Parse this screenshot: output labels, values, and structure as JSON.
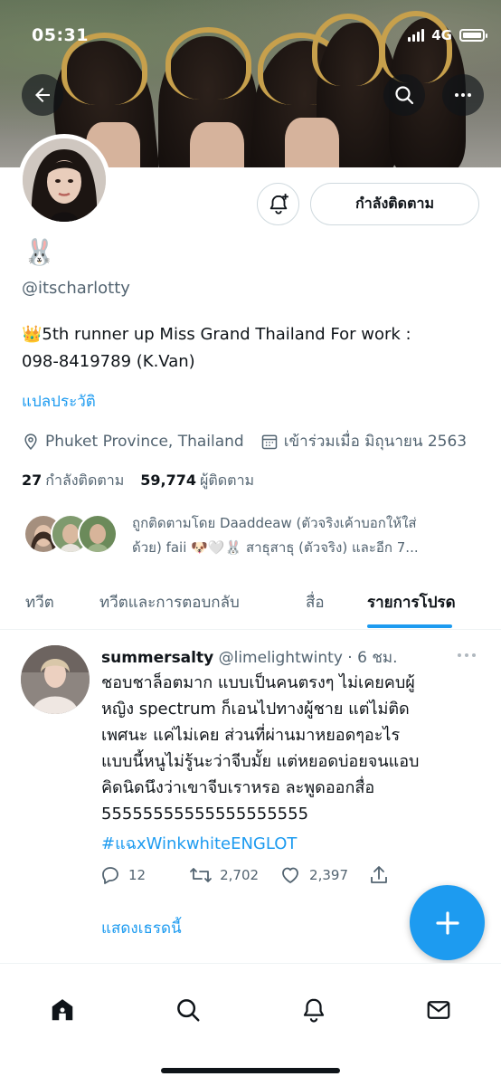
{
  "status_bar": {
    "time": "05:31",
    "network": "4G"
  },
  "profile": {
    "name_emoji": "🐰",
    "handle": "@itscharlotty",
    "bio_line1": "👑5th runner up Miss Grand Thailand For work :",
    "bio_line2": "098-8419789 (K.Van)",
    "translate_label": "แปลประวัติ",
    "location": "Phuket Province, Thailand",
    "joined": "เข้าร่วมเมื่อ มิถุนายน 2563",
    "following_count": "27",
    "following_label": "กำลังติดตาม",
    "followers_count": "59,774",
    "followers_label": "ผู้ติดตาม",
    "followed_by_line1": "ถูกติดตามโดย Daaddeaw (ตัวจริงเค้าบอกให้ใส่",
    "followed_by_line2": "ด้วย) faii 🐶🤍🐰 สาธุสาธุ (ตัวจริง) และอีก 7...",
    "follow_button_label": "กำลังติดตาม"
  },
  "tabs": [
    {
      "label": "ทวีต"
    },
    {
      "label": "ทวีตและการตอบกลับ"
    },
    {
      "label": "สื่อ"
    },
    {
      "label": "รายการโปรด"
    }
  ],
  "tweet": {
    "author_name": "summersalty",
    "author_handle": "@limelightwinty",
    "time": "· 6 ชม.",
    "lines": [
      "ชอบชาล็อตมาก แบบเป็นคนตรงๆ ไม่เคยคบผู้",
      "หญิง spectrum ก็เอนไปทางผู้ชาย แต่ไม่ติด",
      "เพศนะ แค่ไม่เคย ส่วนที่ผ่านมาหยอดๆอะไร",
      "แบบนี้หนูไม่รู้นะว่าจีบมั้ย แต่หยอดบ่อยจนแอบ",
      "คิดนิดนึงว่าเขาจีบเราหรอ ละพูดออกสื่อ",
      "55555555555555555555"
    ],
    "hashtag": "#แฉxWinkwhiteENGLOT",
    "replies": "12",
    "retweets": "2,702",
    "likes": "2,397",
    "show_thread": "แสดงเธรดนี้"
  },
  "colors": {
    "accent": "#1d9bf0",
    "text_primary": "#0f1419",
    "text_secondary": "#536471",
    "border": "#cfd9de"
  },
  "icons": {
    "back": "arrow-left-icon",
    "search": "search-icon",
    "more": "more-horizontal-icon",
    "notify": "bell-plus-icon",
    "location": "location-pin-icon",
    "calendar": "calendar-icon",
    "reply": "reply-icon",
    "retweet": "retweet-icon",
    "like": "heart-icon",
    "share": "share-icon",
    "compose": "plus-icon",
    "nav": [
      "home-icon",
      "search-icon",
      "bell-icon",
      "mail-icon"
    ]
  }
}
